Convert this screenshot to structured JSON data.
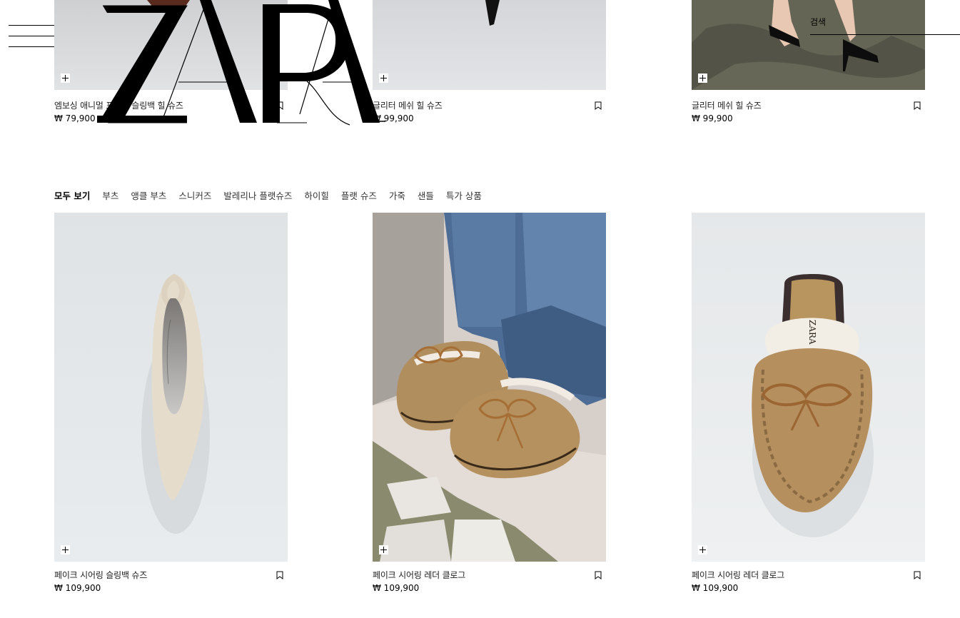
{
  "header": {
    "logo_text": "ZARA",
    "search_label": "검색"
  },
  "top_products": [
    {
      "name": "엠보싱 애니멀 프린트 슬링백 힐 슈즈",
      "price": "₩ 79,900"
    },
    {
      "name": "글리터 메쉬 힐 슈즈",
      "price": "₩ 99,900"
    },
    {
      "name": "글리터 메쉬 힐 슈즈",
      "price": "₩ 99,900"
    }
  ],
  "categories": [
    {
      "label": "모두 보기",
      "active": true
    },
    {
      "label": "부츠"
    },
    {
      "label": "앵클 부츠"
    },
    {
      "label": "스니커즈"
    },
    {
      "label": "발레리나 플랫슈즈"
    },
    {
      "label": "하이힐"
    },
    {
      "label": "플랫 슈즈"
    },
    {
      "label": "가죽"
    },
    {
      "label": "샌들"
    },
    {
      "label": "특가 상품"
    }
  ],
  "products": [
    {
      "name": "페이크 시어링 슬링백 슈즈",
      "price": "₩ 109,900"
    },
    {
      "name": "페이크 시어링 레더 클로그",
      "price": "₩ 109,900"
    },
    {
      "name": "페이크 시어링 레더 클로그",
      "price": "₩ 109,900"
    }
  ],
  "icons": {
    "menu": "hamburger-menu-icon",
    "bookmark": "bookmark-icon",
    "add": "plus-icon"
  },
  "colors": {
    "image_bg": "#e4e6e8",
    "text_primary": "#000000",
    "text_secondary": "#333333"
  }
}
